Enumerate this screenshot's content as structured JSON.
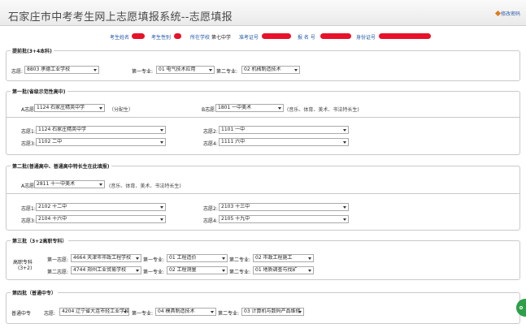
{
  "header": {
    "title": "石家庄市中考考生网上志愿填报系统--志愿填报",
    "edit_link": "修改密码"
  },
  "info": {
    "name_label": "考生姓名",
    "gender_label": "考生性别",
    "school_label": "所在学校",
    "school_value": "第七中学",
    "exam_label": "准考证号",
    "ticket_label": "报 名 号",
    "id_label": "身份证号"
  },
  "early": {
    "legend": "提前批(3+4本科)",
    "choice_label": "志愿:",
    "choice_value": "8803 承德工业学校",
    "major1_label": "第一专业:",
    "major1_value": "01 电气技术应用",
    "major2_label": "第二专业:",
    "major2_value": "02 机械制造技术"
  },
  "batch1": {
    "legend": "第一批(省级示范性高中)",
    "a_label": "A志愿",
    "a_value": "1124 石家庄精英中学",
    "a_note": "（分配生）",
    "b_label": "B志愿",
    "b_value": "1801 一中美术",
    "b_note": "(音乐、体育、美术、书法特长生)",
    "choices": [
      {
        "label": "志愿1:",
        "value": "1124 石家庄精英中学"
      },
      {
        "label": "志愿2:",
        "value": "1101 一中"
      },
      {
        "label": "志愿3:",
        "value": "1102 二中"
      },
      {
        "label": "志愿4:",
        "value": "1111 六中"
      }
    ]
  },
  "batch2": {
    "legend": "第二批(普通高中、普通高中特长生在此填报)",
    "a_label": "A志愿",
    "a_value": "2811 十一中美术",
    "a_note": "(音乐、体育、美术、书法特长生)",
    "choices": [
      {
        "label": "志愿1:",
        "value": "2102 十二中"
      },
      {
        "label": "志愿2:",
        "value": "2103 十三中"
      },
      {
        "label": "志愿3:",
        "value": "2104 十六中"
      },
      {
        "label": "志愿4:",
        "value": "2105 十九中"
      }
    ]
  },
  "batch3": {
    "legend": "第三批（3+2高职专科）",
    "group_label": "高职专科",
    "group_sub": "(3+2)",
    "rows": [
      {
        "choice_label": "第一志愿:",
        "choice_value": "4664 天津市市政工程学校",
        "m1_label": "第一专业:",
        "m1_value": "01 工程造价",
        "m2_label": "第二专业:",
        "m2_value": "02 市政工程施工"
      },
      {
        "choice_label": "第二志愿:",
        "choice_value": "4744 郑州工业贸易学校",
        "m1_label": "第一专业:",
        "m1_value": "02 工程测量",
        "m2_label": "第二专业:",
        "m2_value": "01 地质调查与找矿"
      }
    ]
  },
  "batch4": {
    "legend": "第四批（普通中专）",
    "group_label": "普通中专",
    "choice_label": "志愿:",
    "choice_value": "4204 辽宁省大连市轻工业学校",
    "m1_label": "第一专业:",
    "m1_value": "04 模具制造技术",
    "m2_label": "第二专业:",
    "m2_value": "03 计算机与数码产品维修"
  }
}
